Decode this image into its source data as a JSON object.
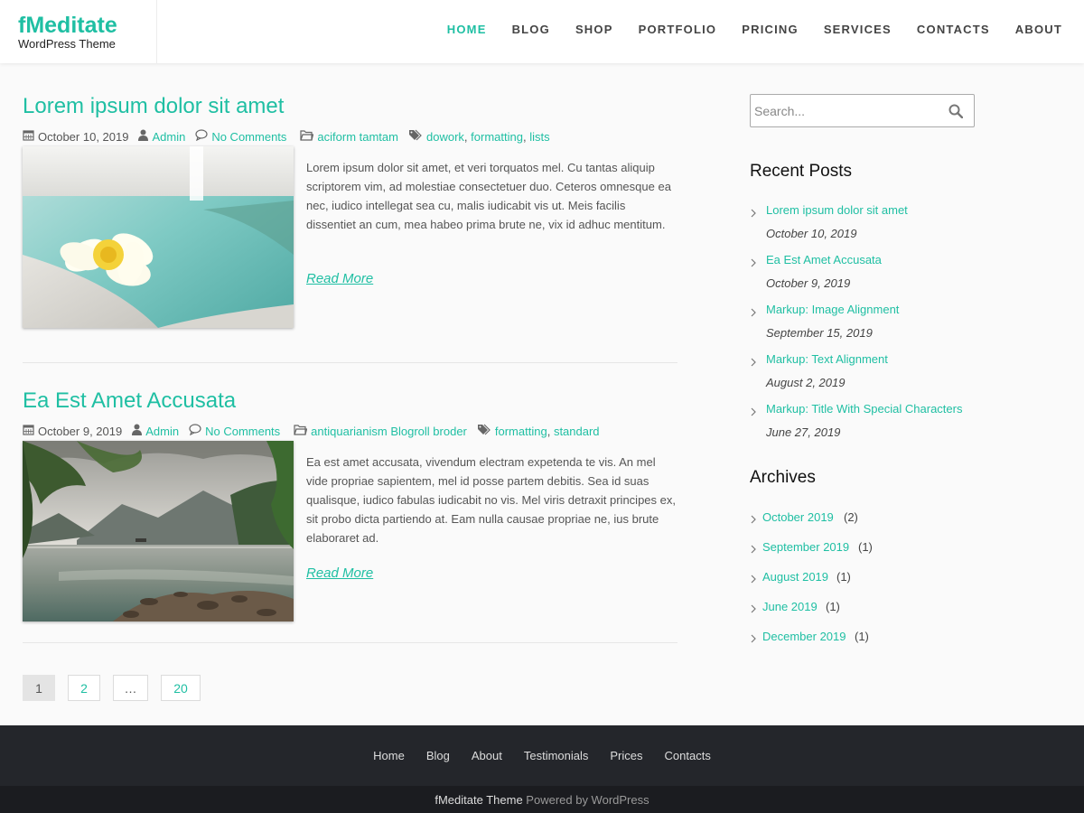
{
  "header": {
    "site_title": "fMeditate",
    "site_description": "WordPress Theme",
    "nav": [
      {
        "label": "HOME",
        "active": true
      },
      {
        "label": "BLOG"
      },
      {
        "label": "SHOP"
      },
      {
        "label": "PORTFOLIO"
      },
      {
        "label": "PRICING"
      },
      {
        "label": "SERVICES"
      },
      {
        "label": "CONTACTS"
      },
      {
        "label": "ABOUT"
      }
    ]
  },
  "posts": [
    {
      "title": "Lorem ipsum dolor sit amet",
      "date": "October 10, 2019",
      "author": "Admin",
      "comments": "No Comments",
      "categories": "aciform tamtam",
      "tags": [
        "dowork",
        "formatting",
        "lists"
      ],
      "separator": ",",
      "excerpt": "Lorem ipsum dolor sit amet, et veri torquatos mel. Cu tantas aliquip scriptorem vim, ad molestiae consectetuer duo. Ceteros omnesque ea nec, iudico intellegat sea cu, malis iudicabit vis ut. Meis facilis dissentiet an cum, mea habeo prima brute ne, vix id adhuc mentitum.",
      "read_more": "Read More",
      "image": "plumeria-flower-by-pool"
    },
    {
      "title": "Ea Est Amet Accusata",
      "date": "October 9, 2019",
      "author": "Admin",
      "comments": "No Comments",
      "categories": "antiquarianism Blogroll broder",
      "tags": [
        "formatting",
        "standard"
      ],
      "separator": ",",
      "excerpt": "Ea est amet accusata, vivendum electram expetenda te vis. An mel vide propriae sapientem, mel id posse partem debitis. Sea id suas qualisque, iudico fabulas iudicabit no vis. Mel viris detraxit principes ex, sit probo dicta partiendo at. Eam nulla causae propriae ne, ius brute elaboraret ad.",
      "read_more": "Read More",
      "image": "mountain-lake-with-trees"
    }
  ],
  "pagination": [
    "1",
    "2",
    "…",
    "20"
  ],
  "sidebar": {
    "search_placeholder": "Search...",
    "recent_title": "Recent Posts",
    "recent_posts": [
      {
        "title": "Lorem ipsum dolor sit amet",
        "date": "October 10, 2019"
      },
      {
        "title": "Ea Est Amet Accusata",
        "date": "October 9, 2019"
      },
      {
        "title": "Markup: Image Alignment",
        "date": "September 15, 2019"
      },
      {
        "title": "Markup: Text Alignment",
        "date": "August 2, 2019"
      },
      {
        "title": "Markup: Title With Special Characters",
        "date": "June 27, 2019"
      }
    ],
    "archives_title": "Archives",
    "archives": [
      {
        "label": "October 2019",
        "count": "(2)"
      },
      {
        "label": "September 2019",
        "count": "(1)"
      },
      {
        "label": "August 2019",
        "count": "(1)"
      },
      {
        "label": "June 2019",
        "count": "(1)"
      },
      {
        "label": "December 2019",
        "count": "(1)"
      }
    ]
  },
  "footer": {
    "nav": [
      "Home",
      "Blog",
      "About",
      "Testimonials",
      "Prices",
      "Contacts"
    ],
    "theme_link": "fMeditate Theme",
    "powered_by": "Powered by WordPress"
  },
  "colors": {
    "accent": "#1fbfa3",
    "footer_bg": "#24262b",
    "footer_bottom_bg": "#1b1c20"
  }
}
